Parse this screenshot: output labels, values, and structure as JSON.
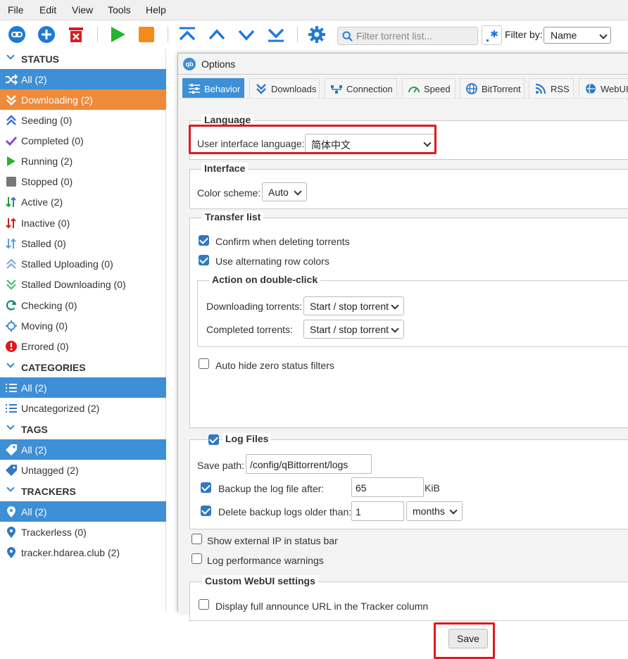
{
  "menubar": {
    "items": [
      "File",
      "Edit",
      "View",
      "Tools",
      "Help"
    ]
  },
  "toolbar": {
    "filter_placeholder": "Filter torrent list...",
    "filter_by_label": "Filter by:",
    "filter_by_value": "Name",
    "icons": [
      "add-link-icon",
      "add-torrent-icon",
      "delete-icon",
      "start-icon",
      "stop-icon",
      "move-top-icon",
      "move-up-icon",
      "move-down-icon",
      "move-bottom-icon",
      "options-icon"
    ]
  },
  "sidebar": {
    "status_header": "STATUS",
    "status": [
      {
        "label": "All (2)",
        "icon": "shuffle-icon"
      },
      {
        "label": "Downloading (2)",
        "icon": "download-icon"
      },
      {
        "label": "Seeding (0)",
        "icon": "upload-icon"
      },
      {
        "label": "Completed (0)",
        "icon": "check-icon"
      },
      {
        "label": "Running (2)",
        "icon": "play-icon"
      },
      {
        "label": "Stopped (0)",
        "icon": "stop-icon"
      },
      {
        "label": "Active (2)",
        "icon": "updown-icon"
      },
      {
        "label": "Inactive (0)",
        "icon": "updown-red-icon"
      },
      {
        "label": "Stalled (0)",
        "icon": "stalled-icon"
      },
      {
        "label": "Stalled Uploading (0)",
        "icon": "stalled-upload-icon"
      },
      {
        "label": "Stalled Downloading (0)",
        "icon": "stalled-download-icon"
      },
      {
        "label": "Checking (0)",
        "icon": "refresh-icon"
      },
      {
        "label": "Moving (0)",
        "icon": "target-icon"
      },
      {
        "label": "Errored (0)",
        "icon": "error-icon"
      }
    ],
    "categories_header": "CATEGORIES",
    "categories": [
      {
        "label": "All (2)",
        "icon": "list-icon"
      },
      {
        "label": "Uncategorized (2)",
        "icon": "list-icon"
      }
    ],
    "tags_header": "TAGS",
    "tags": [
      {
        "label": "All (2)",
        "icon": "tag-icon"
      },
      {
        "label": "Untagged (2)",
        "icon": "tag-icon"
      }
    ],
    "trackers_header": "TRACKERS",
    "trackers": [
      {
        "label": "All (2)",
        "icon": "pin-icon"
      },
      {
        "label": "Trackerless (0)",
        "icon": "pin-icon"
      },
      {
        "label": "tracker.hdarea.club (2)",
        "icon": "pin-icon"
      }
    ]
  },
  "dialog": {
    "title": "Options",
    "tabs": [
      {
        "label": "Behavior",
        "icon": "behavior-icon"
      },
      {
        "label": "Downloads",
        "icon": "downloads-icon"
      },
      {
        "label": "Connection",
        "icon": "connection-icon"
      },
      {
        "label": "Speed",
        "icon": "speed-icon"
      },
      {
        "label": "BitTorrent",
        "icon": "globe-icon"
      },
      {
        "label": "RSS",
        "icon": "rss-icon"
      },
      {
        "label": "WebUI",
        "icon": "webui-icon"
      }
    ],
    "language": {
      "legend": "Language",
      "label": "User interface language:",
      "value": "简体中文"
    },
    "interface": {
      "legend": "Interface",
      "color_label": "Color scheme:",
      "color_value": "Auto"
    },
    "transfer": {
      "legend": "Transfer list",
      "confirm_delete": "Confirm when deleting torrents",
      "alt_rows": "Use alternating row colors",
      "dbl_legend": "Action on double-click",
      "downloading_label": "Downloading torrents:",
      "downloading_value": "Start / stop torrent",
      "completed_label": "Completed torrents:",
      "completed_value": "Start / stop torrent",
      "auto_hide": "Auto hide zero status filters"
    },
    "logs": {
      "legend": "Log Files",
      "save_path_label": "Save path:",
      "save_path_value": "/config/qBittorrent/logs",
      "backup_label": "Backup the log file after:",
      "backup_value": "65",
      "backup_unit": "KiB",
      "delete_label": "Delete backup logs older than:",
      "delete_value": "1",
      "delete_unit": "months"
    },
    "show_ip": "Show external IP in status bar",
    "perf_warn": "Log performance warnings",
    "custom": {
      "legend": "Custom WebUI settings",
      "announce": "Display full announce URL in the Tracker column"
    },
    "save_label": "Save"
  }
}
